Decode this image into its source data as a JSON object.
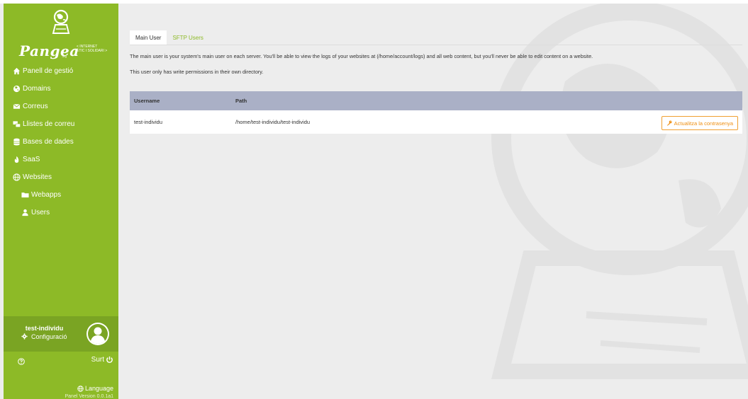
{
  "sidebar": {
    "brand": "Pangea",
    "tagline1": "< INTERNET",
    "tagline2": "ÈTIC I SOLIDARI >",
    "brand_sub": ".org",
    "items": [
      {
        "label": "Panell de gestió",
        "icon": "home-icon"
      },
      {
        "label": "Domains",
        "icon": "globe-icon"
      },
      {
        "label": "Correus",
        "icon": "envelope-icon"
      },
      {
        "label": "Llistes de correu",
        "icon": "mailing-list-icon"
      },
      {
        "label": "Bases de dades",
        "icon": "database-icon"
      },
      {
        "label": "SaaS",
        "icon": "fire-icon"
      },
      {
        "label": "Websites",
        "icon": "globe-icon"
      },
      {
        "label": "Webapps",
        "icon": "folder-icon"
      },
      {
        "label": "Users",
        "icon": "user-icon"
      }
    ],
    "user": {
      "name": "test-individu",
      "config_label": "Configuració"
    },
    "logout_label": "Surt",
    "language_label": "Language",
    "version": "Panel Version 0.0.1a1",
    "colors": {
      "background": "#8dba27",
      "user_panel": "#7aa423"
    }
  },
  "main": {
    "tabs": [
      {
        "label": "Main User",
        "active": true
      },
      {
        "label": "SFTP Users",
        "active": false
      }
    ],
    "description1": "The main user is your system's main user on each server. You'll be able to view the logs of your websites at (/home/account/logs) and all web content, but you'll never be able to edit content on a website.",
    "description2": "This user only has write permissions in their own directory.",
    "table": {
      "headers": [
        "Username",
        "Path"
      ],
      "rows": [
        {
          "username": "test-individu",
          "path": "/home/test-individu/test-individu",
          "action": "Actualitza la contrasenya"
        }
      ]
    },
    "colors": {
      "accent": "#8dba27",
      "table_header": "#aab0c6",
      "action": "#ef8f12"
    }
  }
}
